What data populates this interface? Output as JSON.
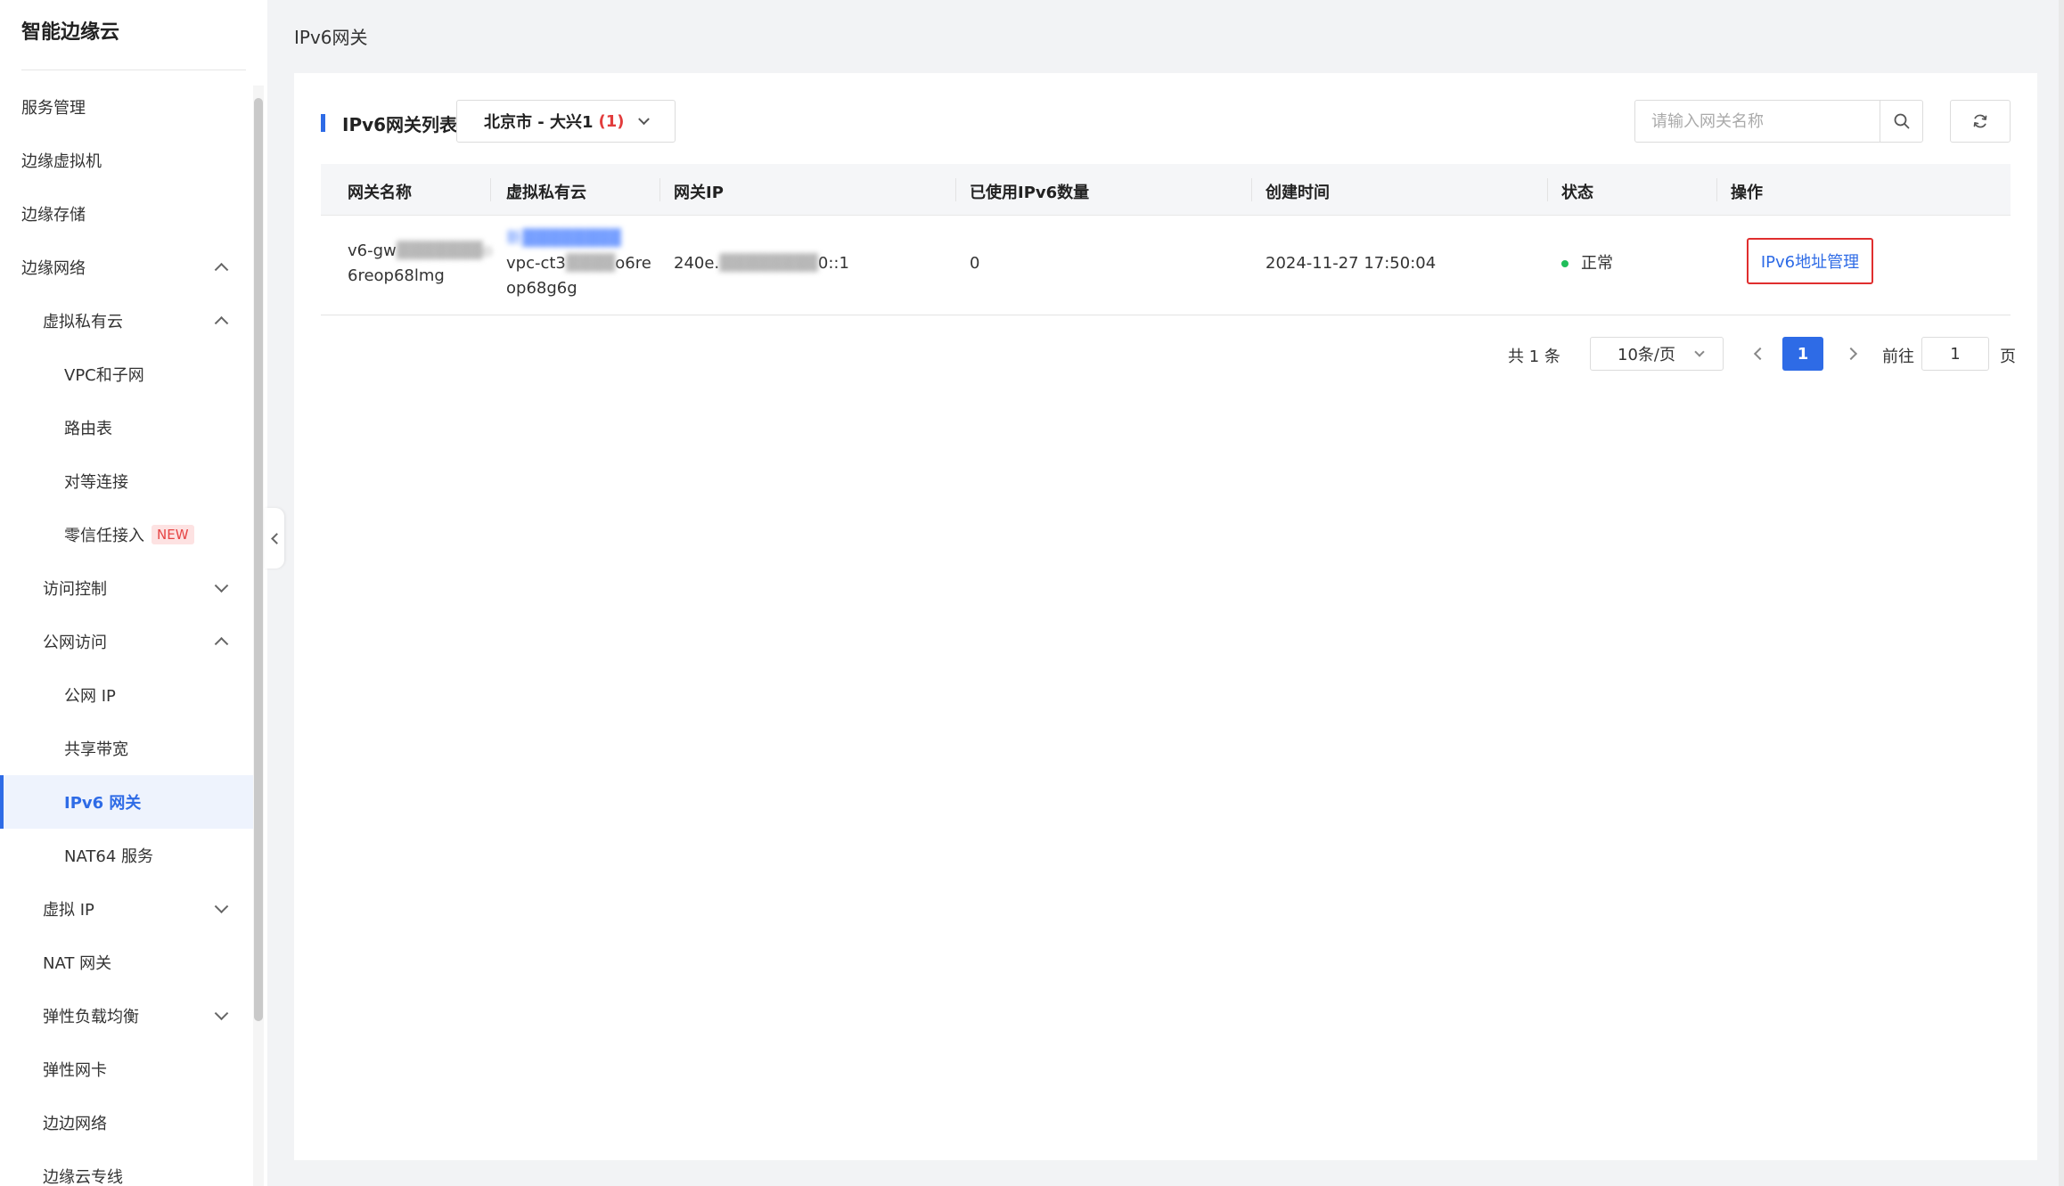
{
  "sidebar": {
    "brand": "智能边缘云",
    "items": [
      {
        "label": "服务管理",
        "level": 1
      },
      {
        "label": "边缘虚拟机",
        "level": 1
      },
      {
        "label": "边缘存储",
        "level": 1
      },
      {
        "label": "边缘网络",
        "level": 1,
        "chevron": "up"
      },
      {
        "label": "虚拟私有云",
        "level": 2,
        "chevron": "up"
      },
      {
        "label": "VPC和子网",
        "level": 3
      },
      {
        "label": "路由表",
        "level": 3
      },
      {
        "label": "对等连接",
        "level": 3
      },
      {
        "label": "零信任接入",
        "level": 3,
        "badge": "NEW"
      },
      {
        "label": "访问控制",
        "level": 2,
        "chevron": "down"
      },
      {
        "label": "公网访问",
        "level": 2,
        "chevron": "up"
      },
      {
        "label": "公网 IP",
        "level": 3
      },
      {
        "label": "共享带宽",
        "level": 3
      },
      {
        "label": "IPv6 网关",
        "level": 3,
        "active": true
      },
      {
        "label": "NAT64 服务",
        "level": 3
      },
      {
        "label": "虚拟 IP",
        "level": 2,
        "chevron": "down"
      },
      {
        "label": "NAT 网关",
        "level": 2
      },
      {
        "label": "弹性负载均衡",
        "level": 2,
        "chevron": "down"
      },
      {
        "label": "弹性网卡",
        "level": 2
      },
      {
        "label": "边边网络",
        "level": 2
      },
      {
        "label": "边缘云专线",
        "level": 2
      }
    ]
  },
  "page": {
    "title": "IPv6网关"
  },
  "toolbar": {
    "section_title": "IPv6网关列表",
    "region": "北京市 - 大兴1",
    "region_count": "(1)",
    "search_placeholder": "请输入网关名称"
  },
  "table": {
    "headers": [
      "网关名称",
      "虚拟私有云",
      "网关IP",
      "已使用IPv6数量",
      "创建时间",
      "状态",
      "操作"
    ],
    "rows": [
      {
        "name_line1": "v6-gw",
        "name_line2": "6reop68lmg",
        "vpc_name": "新",
        "vpc_id_line1": "vpc-ct3",
        "vpc_id_line1_end": "o6re",
        "vpc_id_line2": "op68g6g",
        "ip_start": "240e.",
        "ip_end": "0::1",
        "used_count": "0",
        "created": "2024-11-27 17:50:04",
        "status": "正常",
        "action": "IPv6地址管理"
      }
    ]
  },
  "pagination": {
    "total": "共 1 条",
    "page_size": "10条/页",
    "current": "1",
    "goto_label": "前往",
    "goto_value": "1",
    "page_unit": "页"
  },
  "colors": {
    "accent": "#2e6be6",
    "status_ok": "#1fbe5a",
    "highlight": "#e02e2e"
  }
}
